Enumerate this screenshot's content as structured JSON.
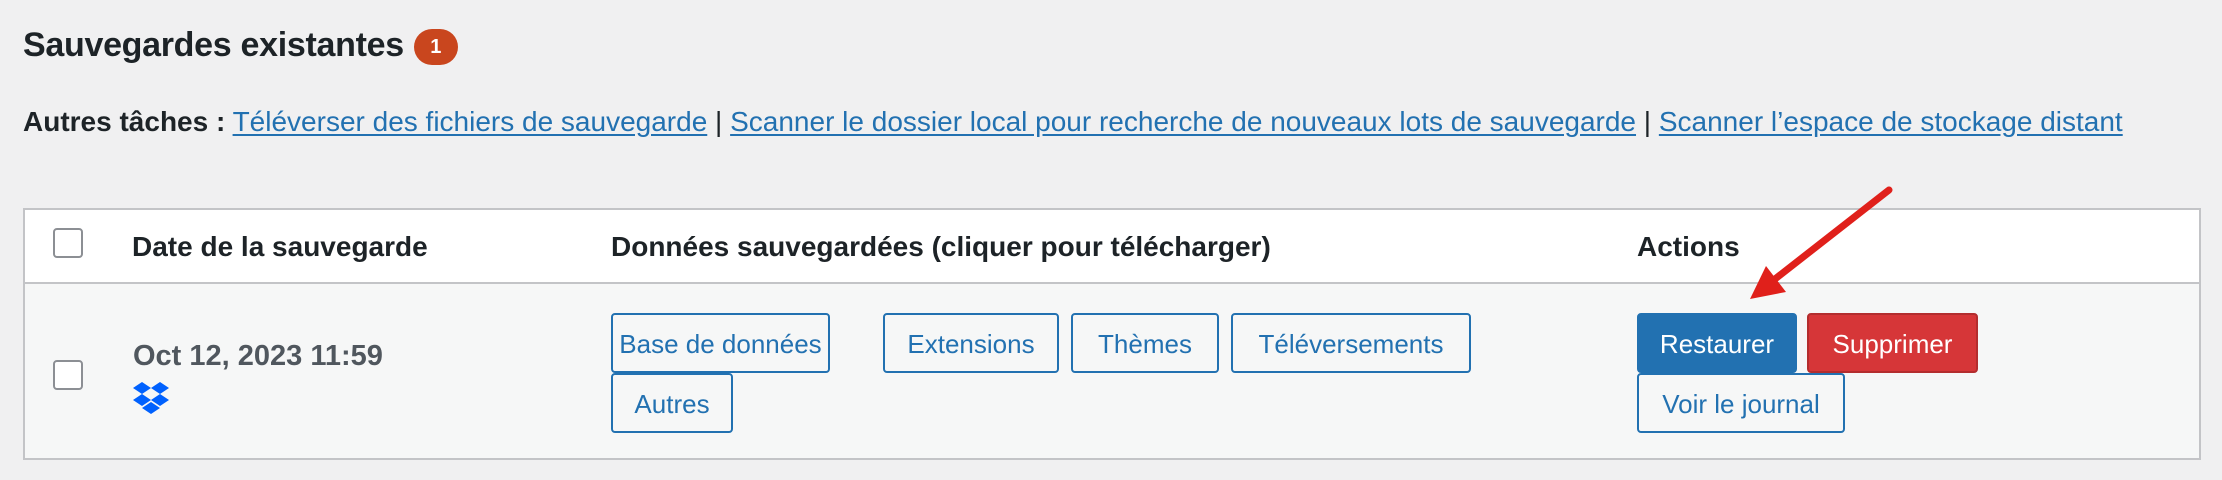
{
  "header": {
    "title": "Sauvegardes existantes",
    "count_badge": "1"
  },
  "tasks": {
    "label": "Autres tâches :",
    "separator": "|",
    "links": [
      "Téléverser des fichiers de sauvegarde",
      "Scanner le dossier local pour recherche de nouveaux lots de sauvegarde",
      "Scanner l’espace de stockage distant"
    ]
  },
  "table": {
    "columns": {
      "date": "Date de la sauvegarde",
      "data": "Données sauvegardées (cliquer pour télécharger)",
      "actions": "Actions"
    },
    "rows": [
      {
        "date": "Oct 12, 2023 11:59",
        "storage_icon": "dropbox-icon",
        "data_buttons": [
          "Base de données",
          "Extensions",
          "Thèmes",
          "Téléversements",
          "Autres"
        ],
        "actions": {
          "restore": "Restaurer",
          "delete": "Supprimer",
          "view_log": "Voir le journal"
        }
      }
    ]
  },
  "colors": {
    "accent": "#2271b1",
    "danger": "#d63638",
    "badge": "#c9461e",
    "annotation_arrow": "#e0201b"
  }
}
